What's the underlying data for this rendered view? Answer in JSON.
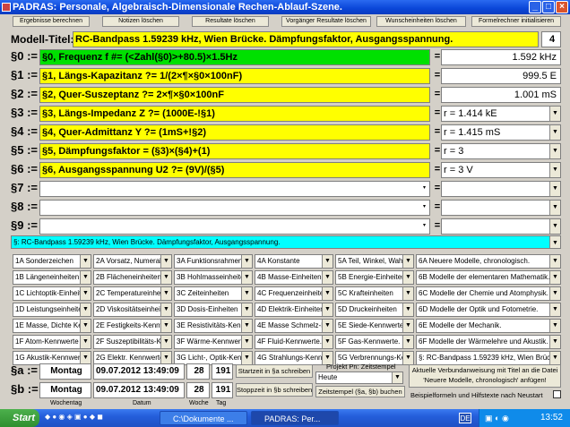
{
  "window": {
    "title": "PADRAS: Personale, Algebraisch-Dimensionale Rechen-Ablauf-Szene."
  },
  "toolbar": [
    "Ergebnisse berechnen",
    "Notizen löschen",
    "Resultate löschen",
    "Vorgänger Resultate löschen",
    "Wunscheinheiten löschen",
    "Formelrechner initialisieren"
  ],
  "model": {
    "label": "Modell-Titel:",
    "title": "RC-Bandpass 1.59239 kHz, Wien Brücke. Dämpfungsfaktor, Ausgangsspannung.",
    "count": "4"
  },
  "rows": [
    {
      "label": "§0 :=",
      "formula": "§0, Frequenz f #= (<Zahl(§0)>+80.5)×1.5Hz",
      "result": "1.592 kHz",
      "dropdown": false
    },
    {
      "label": "§1 :=",
      "formula": "§1, Längs-Kapazitanz ?= 1/(2×¶×§0×100nF)",
      "result": "999.5 E",
      "dropdown": false
    },
    {
      "label": "§2 :=",
      "formula": "§2, Quer-Suszeptanz ?= 2×¶×§0×100nF",
      "result": "1.001 mS",
      "dropdown": false
    },
    {
      "label": "§3 :=",
      "formula": "§3, Längs-Impedanz Z ?= (1000E-!§1)",
      "result": "r = 1.414 kE",
      "dropdown": true
    },
    {
      "label": "§4 :=",
      "formula": "§4, Quer-Admittanz Y ?= (1mS+!§2)",
      "result": "r = 1.415 mS",
      "dropdown": true
    },
    {
      "label": "§5 :=",
      "formula": "§5, Dämpfungsfaktor = (§3)×(§4)+(1)",
      "result": "r = 3",
      "dropdown": true
    },
    {
      "label": "§6 :=",
      "formula": "§6, Ausgangsspannung U2 ?= (9V)/(§5)",
      "result": "r = 3 V",
      "dropdown": true
    },
    {
      "label": "§7 :=",
      "formula": "",
      "result": "",
      "dropdown": true
    },
    {
      "label": "§8 :=",
      "formula": "",
      "result": "",
      "dropdown": true
    },
    {
      "label": "§9 :=",
      "formula": "",
      "result": "",
      "dropdown": true
    }
  ],
  "eq_sign": "=",
  "note_line": "§: RC-Bandpass 1.59239 kHz, Wien Brücke. Dämpfungsfaktor, Ausgangsspannung.",
  "grid": [
    [
      "1A Sonderzeichen",
      "2A Vorsatz, Numeral",
      "3A Funktionsrahmen",
      "4A Konstante",
      "5A Teil, Winkel, Wahr",
      "6A Neuere Modelle, chronologisch."
    ],
    [
      "1B Längeneinheiten",
      "2B Flächeneinheiten",
      "3B Hohlmasseinheiten",
      "4B Masse-Einheiten",
      "5B Energie-Einheiten",
      "6B Modelle der elementaren Mathematik."
    ],
    [
      "1C Lichtoptik-Einheit",
      "2C Temperatureinhe",
      "3C Zeiteinheiten",
      "4C Frequenzeinheiten",
      "5C Krafteinheiten",
      "6C Modelle der Chemie und Atomphysik."
    ],
    [
      "1D Leistungseinheiten",
      "2D Viskositätseinheit",
      "3D Dosis-Einheiten",
      "4D Elektrik-Einheiten",
      "5D Druckeinheiten",
      "6D Modelle der Optik und Fotometrie."
    ],
    [
      "1E Masse, Dichte Ke",
      "2E Festigkeits-Kennw",
      "3E Resistivitäts-Kenn",
      "4E Masse Schmelz-I",
      "5E Siede-Kennwerte",
      "6E Modelle der Mechanik."
    ],
    [
      "1F Atom-Kennwerte",
      "2F Suszeptibilitäts-K",
      "3F Wärme-Kennwert",
      "4F Fluid-Kennwerte.",
      "5F Gas-Kennwerte.",
      "6F Modelle der Wärmelehre und Akustik."
    ],
    [
      "1G Akustik-Kennwer",
      "2G Elektr. Kennwerte",
      "3G Licht-, Optik-Ken",
      "4G Strahlungs-Kenn",
      "5G Verbrennungs-Ke",
      "§: RC-Bandpass 1.59239 kHz, Wien Brück"
    ]
  ],
  "timestamps": [
    {
      "label": "§a :=",
      "weekday": "Montag",
      "date": "09.07.2012 13:49:09",
      "week": "28",
      "day": "191",
      "button": "Startzeit in §a schreiben"
    },
    {
      "label": "§b :=",
      "weekday": "Montag",
      "date": "09.07.2012 13:49:09",
      "week": "28",
      "day": "191",
      "button": "Stoppzeit in §b schreiben"
    }
  ],
  "captions": {
    "weekday": "Wochentag",
    "date": "Datum",
    "week": "Woche",
    "day": "Tag"
  },
  "project": {
    "label": "Projekt Pn: Zeitstempel",
    "select": "Heute",
    "button": "Zeitstempel (§a, §b) buchen"
  },
  "right_panel": {
    "button": "Aktuelle Verbundanweisung mit Titel an die Datei 'Neuere Modelle, chronologisch' anfügen!",
    "checkbox_label": "Beispielformeln und Hilfstexte nach Neustart"
  },
  "taskbar": {
    "start": "Start",
    "items": [
      "C:\\Dokumente ...",
      "PADRAS: Per..."
    ],
    "lang": "DE",
    "clock": "13:52"
  },
  "colors": {
    "yellow": "#ffff00",
    "green": "#00e000",
    "cyan": "#00ffff",
    "titlebar": "#0a46d8"
  }
}
